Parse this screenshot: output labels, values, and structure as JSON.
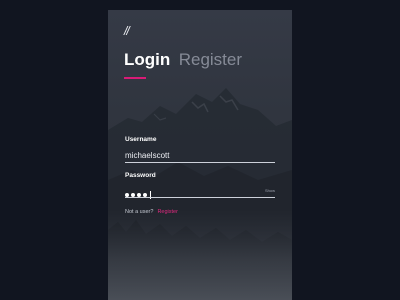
{
  "app": {
    "logo_text": "//"
  },
  "tabs": [
    {
      "label": "Login",
      "active": true
    },
    {
      "label": "Register",
      "active": false
    }
  ],
  "form": {
    "username_label": "Username",
    "username_value": "michaelscott",
    "password_label": "Password",
    "password_masked_count": 4,
    "show_label": "Show"
  },
  "footer": {
    "question": "Not a user?",
    "link": "Register"
  },
  "colors": {
    "accent": "#d81b77",
    "page_background": "#111520",
    "card_background": "#2f3440"
  }
}
